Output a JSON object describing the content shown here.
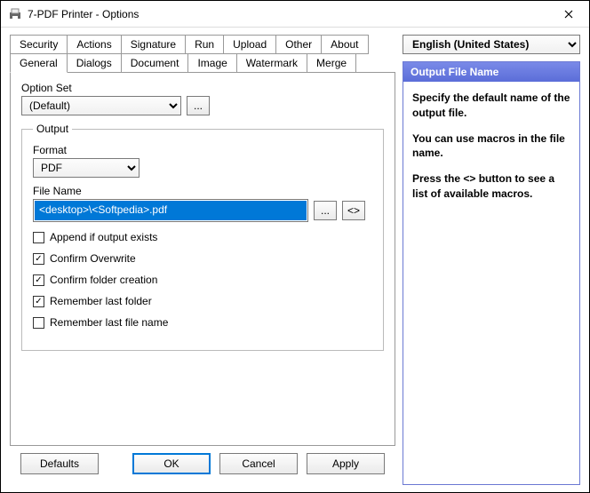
{
  "window": {
    "title": "7-PDF Printer - Options"
  },
  "tabs": {
    "row1": [
      "Security",
      "Actions",
      "Signature",
      "Run",
      "Upload",
      "Other",
      "About"
    ],
    "row2": [
      "General",
      "Dialogs",
      "Document",
      "Image",
      "Watermark",
      "Merge"
    ],
    "active": "General"
  },
  "optionSet": {
    "label": "Option Set",
    "value": "(Default)",
    "browse": "..."
  },
  "output": {
    "legend": "Output",
    "formatLabel": "Format",
    "formatValue": "PDF",
    "fileNameLabel": "File Name",
    "fileNameValue": "<desktop>\\<Softpedia>.pdf",
    "browse": "...",
    "macro": "<>",
    "checks": [
      {
        "label": "Append if output exists",
        "checked": false
      },
      {
        "label": "Confirm Overwrite",
        "checked": true
      },
      {
        "label": "Confirm folder creation",
        "checked": true
      },
      {
        "label": "Remember last folder",
        "checked": true
      },
      {
        "label": "Remember last file name",
        "checked": false
      }
    ]
  },
  "language": {
    "value": "English (United States)"
  },
  "help": {
    "title": "Output File Name",
    "p1": "Specify the default name of the output file.",
    "p2": "You can use macros in the file name.",
    "p3": "Press the <> button to see a list of available macros."
  },
  "buttons": {
    "defaults": "Defaults",
    "ok": "OK",
    "cancel": "Cancel",
    "apply": "Apply"
  }
}
